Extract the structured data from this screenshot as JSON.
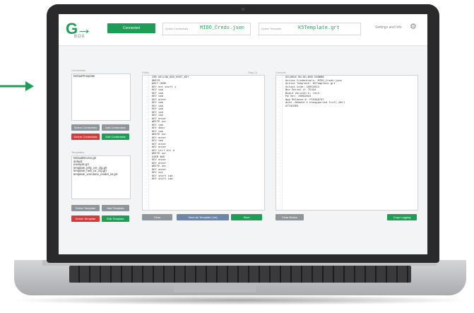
{
  "header": {
    "connect_label": "Connected",
    "cred_label": "Active Credentials",
    "cred_value": "MIDO_Creds.json",
    "template_label": "Active Template",
    "template_value": "K5Template.grt",
    "settings_label": "Settings and Info"
  },
  "credentials": {
    "label": "Credentials",
    "items": [
      "DefaultTemplate"
    ],
    "buttons": {
      "select": "Select Credentials",
      "add": "Add Credentials",
      "delete": "Delete Credentials",
      "edit": "Edit Credentials"
    }
  },
  "templates": {
    "label": "Templates",
    "items": [
      "DefaultDevice.grt",
      "default",
      "example.grt",
      "template_jelly_cnt_cfg.grt",
      "template_new_ivr_cfg.grt",
      "template_xrxrutune_model_ivr.grt"
    ],
    "buttons": {
      "select": "Select Template",
      "add": "Add Template",
      "delete": "Delete Template",
      "edit": "Edit Template"
    }
  },
  "editor": {
    "label": "Editor",
    "hint": "Step (i)",
    "lines": [
      "CMD WILLOW_ADD_HOST_KEY",
      "$KEYS",
      "WAIT HERE",
      "KEY ent shift 1",
      "KEY tab",
      "KEY tab",
      "KEY tab",
      "KEY enter",
      "KEY tab",
      "KEY tab",
      "KEY tab",
      "KEY tab",
      "KEY tab",
      "KEY enter",
      "WRITE usr",
      "KEY tab",
      "KEY 4mix",
      "KEY tab",
      "WRITE usr",
      "KEY enter",
      "KEY tab",
      "KEY enter",
      "KEY enter",
      "KEY ctrl alt d",
      "WRITE usr",
      "USER $KD",
      "KEY enter",
      "KEY enter",
      "WRITE usr",
      "KEY enter",
      "KEY esc",
      "KEY shift tab",
      "KEY shift tab"
    ],
    "buttons": {
      "clear": "Clear",
      "save_as": "Save As Template (.txt)",
      "save": "Save"
    }
  },
  "console": {
    "label": "Console",
    "lines": [
      "GOLDBOX BO-BO-BOB XXBBBB",
      "",
      "Active Credentials: MIDO_Creds.json",
      "Active Template: K5Template.grt",
      "Unlock Code: 16052024",
      "Box Serial #: 75434",
      "Board Version #: rev4",
      "FW Ver: 20082024",
      "App Release #: F534A6797",
      "",
      "auto -Remote's Unsupported Iroll_GAll",
      "ATTACHED"
    ],
    "buttons": {
      "clear": "Clear Button",
      "copy": "Copy Logging"
    }
  },
  "colors": {
    "accent": "#1e9e55",
    "danger": "#d83a3a",
    "neutral": "#8e969b"
  }
}
